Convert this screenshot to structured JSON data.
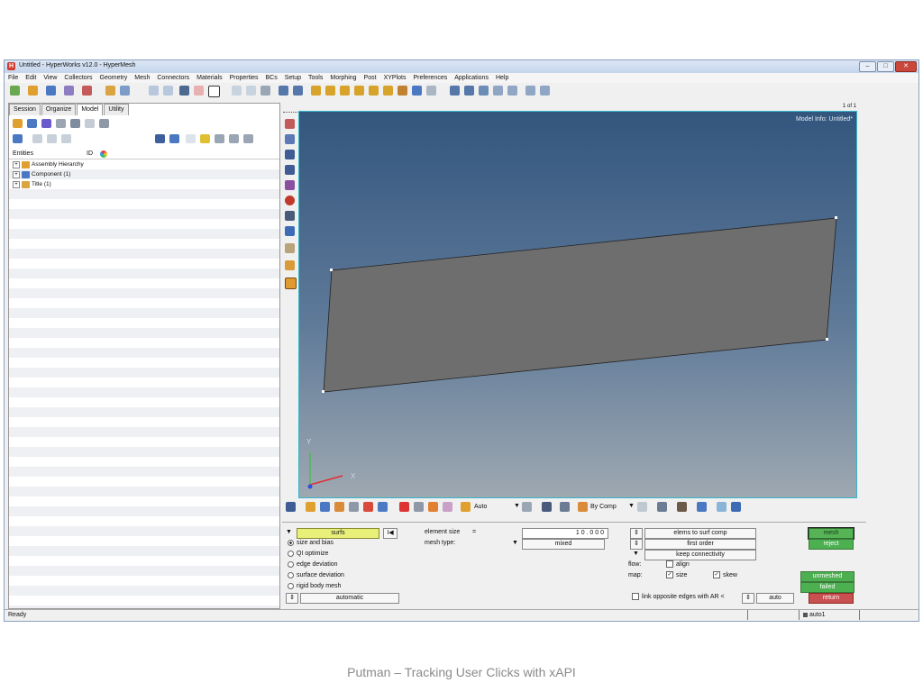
{
  "window": {
    "title": "Untitled - HyperWorks v12.0 - HyperMesh",
    "minimize": "–",
    "maximize": "□",
    "close": "✕"
  },
  "menu": [
    "File",
    "Edit",
    "View",
    "Collectors",
    "Geometry",
    "Mesh",
    "Connectors",
    "Materials",
    "Properties",
    "BCs",
    "Setup",
    "Tools",
    "Morphing",
    "Post",
    "XYPlots",
    "Preferences",
    "Applications",
    "Help"
  ],
  "left_panel": {
    "tabs": [
      "Session",
      "Organize",
      "Model",
      "Utility"
    ],
    "active_tab": "Model",
    "columns": {
      "entities": "Entities",
      "id": "ID"
    },
    "tree": [
      {
        "label": "Assembly Hierarchy",
        "expander": "+"
      },
      {
        "label": "Component (1)",
        "expander": "+"
      },
      {
        "label": "Title (1)",
        "expander": "+"
      }
    ]
  },
  "viewport": {
    "model_info": "Model Info: Untitled*",
    "page": "1 of 1",
    "axis_y": "Y",
    "axis_x": "X"
  },
  "bottom_toolbar": {
    "auto": "Auto",
    "by_comp": "By Comp"
  },
  "mesh_panel": {
    "entity_selector": "surfs",
    "options": [
      {
        "label": "size and bias",
        "selected": true
      },
      {
        "label": "QI optimize",
        "selected": false
      },
      {
        "label": "edge deviation",
        "selected": false
      },
      {
        "label": "surface deviation",
        "selected": false
      },
      {
        "label": "rigid body mesh",
        "selected": false
      }
    ],
    "automatic": "automatic",
    "element_size_label": "element size",
    "element_size_eq": "=",
    "element_size_value": "1 0 . 0 0 0",
    "mesh_type_label": "mesh type:",
    "mesh_type_value": "mixed",
    "elems_to_surf_comp": "elems to surf comp",
    "first_order": "first order",
    "keep_connectivity": "keep connectivity",
    "flow_label": "flow:",
    "align_label": "align",
    "map_label": "map:",
    "size_label": "size",
    "skew_label": "skew",
    "link_label": "link opposite edges with AR <",
    "auto_btn": "auto",
    "mesh_btn": "mesh",
    "reject_btn": "reject",
    "unmeshed_btn": "unmeshed",
    "failed_btn": "failed",
    "return_btn": "return",
    "check_mark": "✓",
    "dropdown_arrow": "▼",
    "updown": "⇕",
    "first_icon": "I◀"
  },
  "status": {
    "left": "Ready",
    "component": "auto1"
  },
  "footer": "Putman – Tracking User Clicks with xAPI",
  "colors": {
    "viewport_top": "#33567e",
    "viewport_bottom": "#9ea8b1",
    "surface": "#6e6e6e",
    "accent_green": "#4caf50",
    "return_red": "#c85050"
  }
}
